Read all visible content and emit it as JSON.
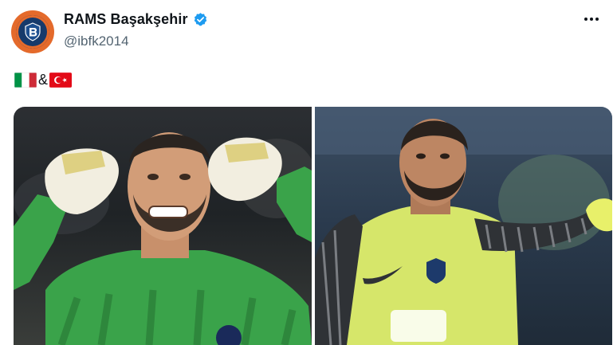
{
  "tweet": {
    "display_name": "RAMS Başakşehir",
    "handle": "@ibfk2014",
    "text_separator": "&",
    "flags": [
      "italy-flag",
      "turkey-flag"
    ],
    "icons": {
      "avatar": "club-crest-icon",
      "verified": "verified-badge-icon",
      "more": "more-options-icon"
    },
    "colors": {
      "verified": "#1d9bf0",
      "avatar_outer": "#e46a2b",
      "avatar_inner": "#163a6b"
    },
    "media": {
      "count": 2,
      "images": [
        {
          "description_icon": "goalkeeper-photo-left"
        },
        {
          "description_icon": "goalkeeper-photo-right"
        }
      ]
    }
  }
}
